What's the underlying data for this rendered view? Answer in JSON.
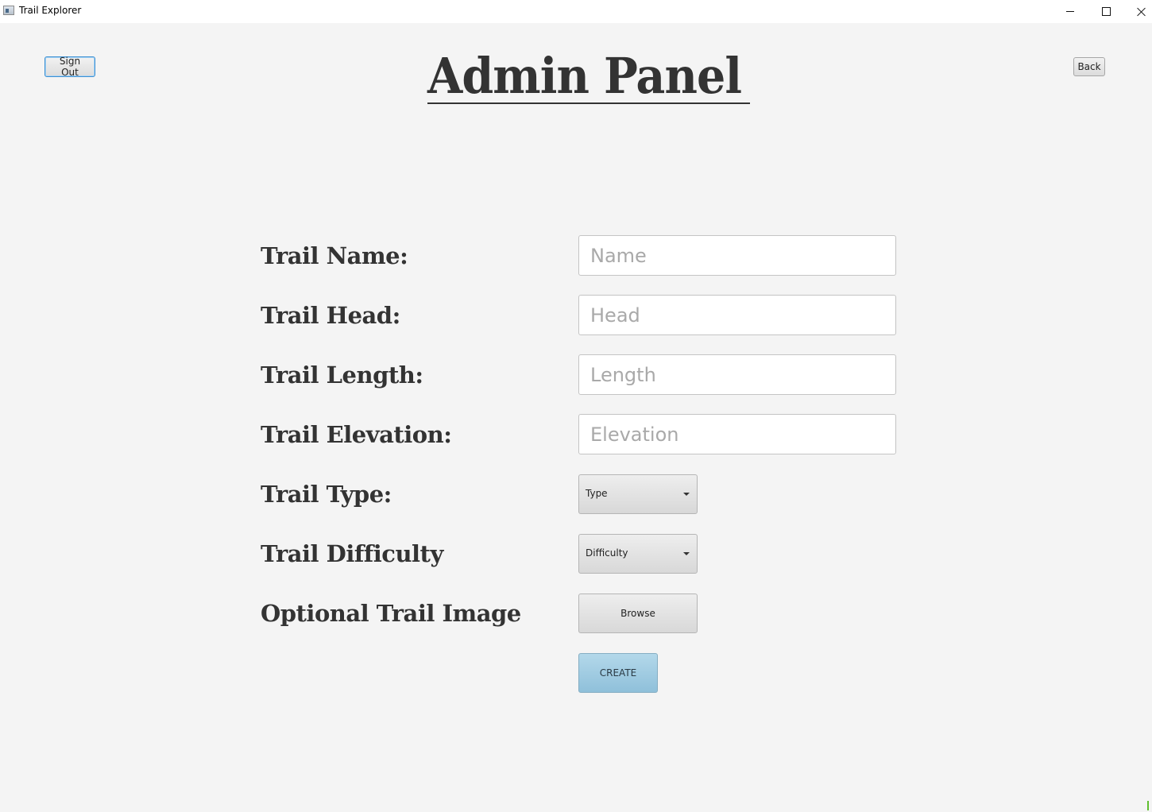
{
  "window": {
    "title": "Trail Explorer"
  },
  "header": {
    "sign_out_label": "Sign Out",
    "back_label": "Back",
    "page_title": "Admin Panel"
  },
  "form": {
    "name": {
      "label": "Trail Name:",
      "placeholder": "Name",
      "value": ""
    },
    "head": {
      "label": "Trail Head:",
      "placeholder": "Head",
      "value": ""
    },
    "length": {
      "label": "Trail Length:",
      "placeholder": "Length",
      "value": ""
    },
    "elevation": {
      "label": "Trail Elevation:",
      "placeholder": "Elevation",
      "value": ""
    },
    "type": {
      "label": "Trail Type:",
      "selected": "Type"
    },
    "difficulty": {
      "label": "Trail Difficulty",
      "selected": "Difficulty"
    },
    "image": {
      "label": "Optional Trail Image",
      "browse_label": "Browse"
    },
    "create_label": "CREATE"
  },
  "icons": {
    "app": "app-window-icon",
    "minimize": "minimize-icon",
    "maximize": "maximize-icon",
    "close": "close-icon",
    "dropdown": "chevron-down-icon"
  },
  "colors": {
    "background": "#f4f4f4",
    "heading_text": "#333333",
    "create_button": "#a3cde3",
    "focus_border": "#3c8fd1"
  }
}
